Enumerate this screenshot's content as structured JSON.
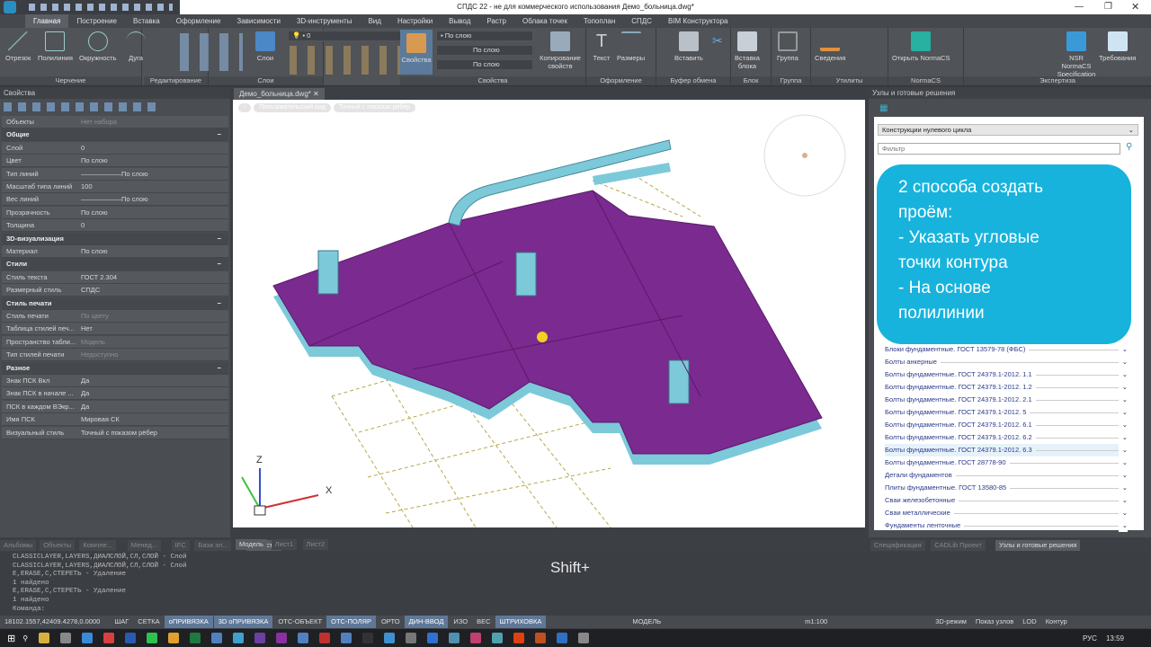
{
  "title": "СПДС 22 - не для коммерческого использования Демо_больница.dwg*",
  "ribbon_tabs": [
    "Главная",
    "Построение",
    "Вставка",
    "Оформление",
    "Зависимости",
    "3D-инструменты",
    "Вид",
    "Настройки",
    "Вывод",
    "Растр",
    "Облака точек",
    "Топоплан",
    "СПДС",
    "BIM Конструктора"
  ],
  "ribbon": {
    "drawing": {
      "label": "Черчение",
      "buttons": [
        "Отрезок",
        "Полилиния",
        "Окружность",
        "Дуга"
      ]
    },
    "editing": {
      "label": "Редактирование"
    },
    "layers": {
      "label": "Слои",
      "button": "Слои",
      "layer_value": "0"
    },
    "properties": {
      "label": "Свойства",
      "button": "Свойства",
      "color": "По слою",
      "linetype": "По слою",
      "lineweight": "По слою",
      "copy": "Копирование свойств"
    },
    "annotation": {
      "label": "Оформление",
      "buttons": [
        "Текст",
        "Размеры"
      ]
    },
    "clipboard": {
      "label": "Буфер обмена",
      "button": "Вставить"
    },
    "block": {
      "label": "Блок",
      "button": "Вставка блока"
    },
    "group": {
      "label": "Группа",
      "button": "Группа"
    },
    "utilities": {
      "label": "Утилиты",
      "button": "Сведения"
    },
    "normacs": {
      "label": "NormaCS",
      "button": "Открыть NormaCS"
    },
    "expertise": {
      "label": "Экспертиза",
      "buttons": [
        "NSR NormaCS Specification",
        "Требования"
      ]
    }
  },
  "properties_panel": {
    "title": "Свойства",
    "rows": [
      {
        "k": "Объекты",
        "v": "Нет набора",
        "dim": true
      },
      {
        "sec": "Общие"
      },
      {
        "k": "Слой",
        "v": "0"
      },
      {
        "k": "Цвет",
        "v": "По слою"
      },
      {
        "k": "Тип линий",
        "v": "——————По слою"
      },
      {
        "k": "Масштаб типа линий",
        "v": "100"
      },
      {
        "k": "Вес линий",
        "v": "——————По слою"
      },
      {
        "k": "Прозрачность",
        "v": "По слою"
      },
      {
        "k": "Толщина",
        "v": "0"
      },
      {
        "sec": "3D-визуализация"
      },
      {
        "k": "Материал",
        "v": "По слою"
      },
      {
        "sec": "Стили"
      },
      {
        "k": "Стиль текста",
        "v": "ГОСТ 2.304"
      },
      {
        "k": "Размерный стиль",
        "v": "СПДС"
      },
      {
        "sec": "Стиль печати"
      },
      {
        "k": "Стиль печати",
        "v": "По цвету",
        "dim": true
      },
      {
        "k": "Таблица стилей печ...",
        "v": "Нет"
      },
      {
        "k": "Пространство табли...",
        "v": "Модель",
        "dim": true
      },
      {
        "k": "Тип стилей печати",
        "v": "Недоступно",
        "dim": true
      },
      {
        "sec": "Разное"
      },
      {
        "k": "Знак ПСК Вкл",
        "v": "Да"
      },
      {
        "k": "Знак ПСК в начале ...",
        "v": "Да"
      },
      {
        "k": "ПСК в каждом ВЭкр...",
        "v": "Да"
      },
      {
        "k": "Имя ПСК",
        "v": "Мировая СК"
      },
      {
        "k": "Визуальный стиль",
        "v": "Точный с показом рёбер"
      }
    ],
    "bottom_tabs": [
      "Альбомы",
      "Объекты",
      "Компле...",
      "Менед...",
      "IFC",
      "База эл...",
      "Свойст..."
    ]
  },
  "document": {
    "tab": "Демо_больница.dwg*",
    "view_pills": [
      "-",
      "Пользовательский вид",
      "Точный с показом рёбер"
    ],
    "layout_tabs": [
      "Модель",
      "Лист1",
      "Лист2"
    ],
    "axis_labels": {
      "z": "Z",
      "x": "X"
    }
  },
  "right_panel": {
    "title": "Узлы и готовые решения",
    "category": "Конструкции нулевого цикла",
    "filter_placeholder": "Фильтр",
    "items": [
      "Блоки фундаментные. ГОСТ 13579-78 (ФБС)",
      "Болты анкерные",
      "Болты фундаментные. ГОСТ 24379.1-2012. 1.1",
      "Болты фундаментные. ГОСТ 24379.1-2012. 1.2",
      "Болты фундаментные. ГОСТ 24379.1-2012. 2.1",
      "Болты фундаментные. ГОСТ 24379.1-2012. 5",
      "Болты фундаментные. ГОСТ 24379.1-2012. 6.1",
      "Болты фундаментные. ГОСТ 24379.1-2012. 6.2",
      "Болты фундаментные. ГОСТ 24379.1-2012. 6.3",
      "Болты фундаментные. ГОСТ 28778-90",
      "Детали фундаментов",
      "Плиты фундаментные. ГОСТ 13580-85",
      "Сваи железобетонные",
      "Сваи металлические",
      "Фундаменты ленточные"
    ],
    "selected_index": 8,
    "bottom_tabs": [
      "Спецификация",
      "CADLib Проект",
      "Узлы и готовые решения"
    ]
  },
  "callout": "2 способа создать\nпроём:\n- Указать угловые\nточки контура\n- На основе\nполилинии",
  "command_history": [
    "CLASSICLAYER,LAYERS,ДИАЛСЛОЙ,СЛ,СЛОЙ - Слой",
    "CLASSICLAYER,LAYERS,ДИАЛСЛОЙ,СЛ,СЛОЙ - Слой",
    "E,ERASE,С,СТЕРЕТЬ - Удаление",
    "1 найдено",
    "E,ERASE,С,СТЕРЕТЬ - Удаление",
    "1 найдено",
    "Команда:"
  ],
  "keystroke_overlay": "Shift+",
  "status": {
    "coords": "18102.1557,42409.4278,0.0000",
    "toggles": [
      {
        "t": "ШАГ",
        "on": false
      },
      {
        "t": "СЕТКА",
        "on": false
      },
      {
        "t": "оПРИВЯЗКА",
        "on": true
      },
      {
        "t": "3D оПРИВЯЗКА",
        "on": true
      },
      {
        "t": "ОТС-ОБЪЕКТ",
        "on": false
      },
      {
        "t": "ОТС-ПОЛЯР",
        "on": true
      },
      {
        "t": "ОРТО",
        "on": false
      },
      {
        "t": "ДИН-ВВОД",
        "on": true
      },
      {
        "t": "ИЗО",
        "on": false
      },
      {
        "t": "ВЕС",
        "on": false
      },
      {
        "t": "ШТРИХОВКА",
        "on": true
      }
    ],
    "model": "МОДЕЛЬ",
    "scale": "m1:100",
    "mode3d": "3D-режим",
    "nodes": "Показ узлов",
    "lod": "LOD",
    "contour": "Контур"
  },
  "taskbar": {
    "lang": "РУС",
    "time": "13:59"
  },
  "colors": {
    "slab": "#7b2a8f",
    "edge": "#7cc9d9",
    "accent": "#17b3dd"
  }
}
